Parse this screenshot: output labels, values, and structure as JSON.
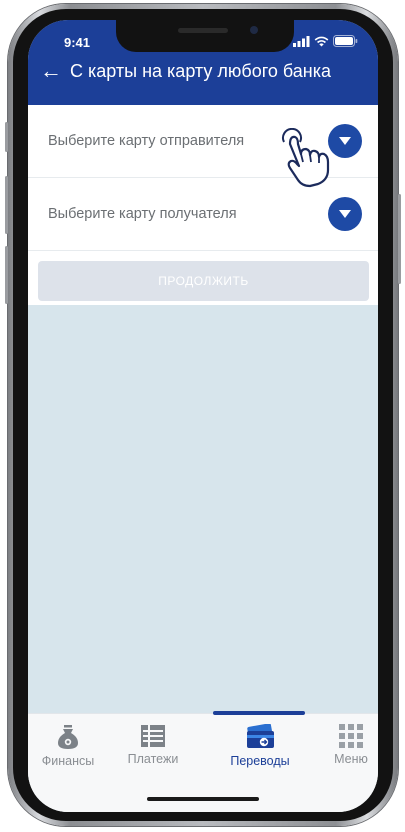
{
  "status_bar": {
    "time": "9:41"
  },
  "header": {
    "title": "С карты на карту любого банка"
  },
  "form": {
    "sender_select": {
      "label": "Выберите карту отправителя"
    },
    "recipient_select": {
      "label": "Выберите карту получателя"
    },
    "continue_label": "ПРОДОЛЖИТЬ"
  },
  "tabs": [
    {
      "label": "Финансы",
      "icon": "money-bag-icon",
      "active": false
    },
    {
      "label": "Платежи",
      "icon": "payments-list-icon",
      "active": false
    },
    {
      "label": "Переводы",
      "icon": "card-transfer-icon",
      "active": true
    },
    {
      "label": "Меню",
      "icon": "grid-menu-icon",
      "active": false
    }
  ],
  "colors": {
    "brand_blue": "#1c3f98",
    "accent_blue": "#1e4aa5",
    "background": "#d7e5ec",
    "disabled_button": "#dde2ea"
  }
}
